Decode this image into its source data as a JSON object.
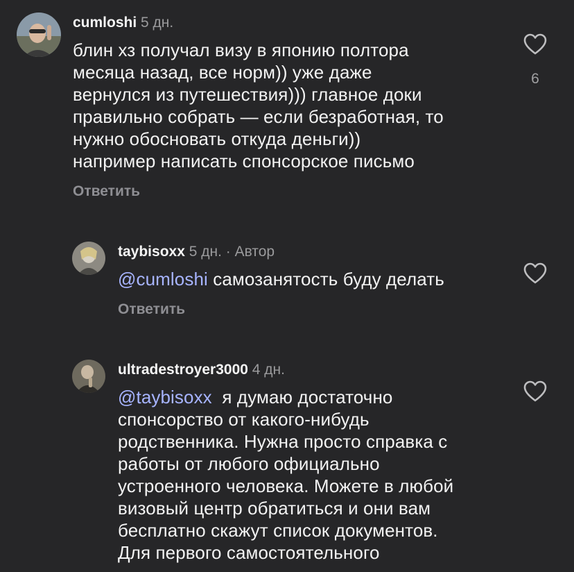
{
  "comments": [
    {
      "username": "cumloshi",
      "time": "5 дн.",
      "text": "блин хз получал визу в японию полтора\nмесяца назад, все норм)) уже даже\nвернулся из путешествия))) главное доки\nправильно собрать — если безработная, то\nнужно обосновать откуда деньги))\nнапример написать спонсорское письмо",
      "reply_label": "Ответить",
      "likes": "6"
    },
    {
      "username": "taybisoxx",
      "time": "5 дн.",
      "author_badge": "· Автор",
      "mention": "@cumloshi",
      "text": " самозанятость буду делать",
      "reply_label": "Ответить"
    },
    {
      "username": "ultradestroyer3000",
      "time": "4 дн.",
      "mention": "@taybisoxx",
      "text": "  я думаю достаточно\nспонсорство от какого-нибудь\nродственника. Нужна просто справка с\nработы от любого официально\nустроенного человека. Можете в любой\nвизовый центр обратиться и они вам\nбесплатно скажут список документов.\nДля первого самостоятельного"
    }
  ],
  "icons": {
    "like": "heart-outline-icon"
  }
}
